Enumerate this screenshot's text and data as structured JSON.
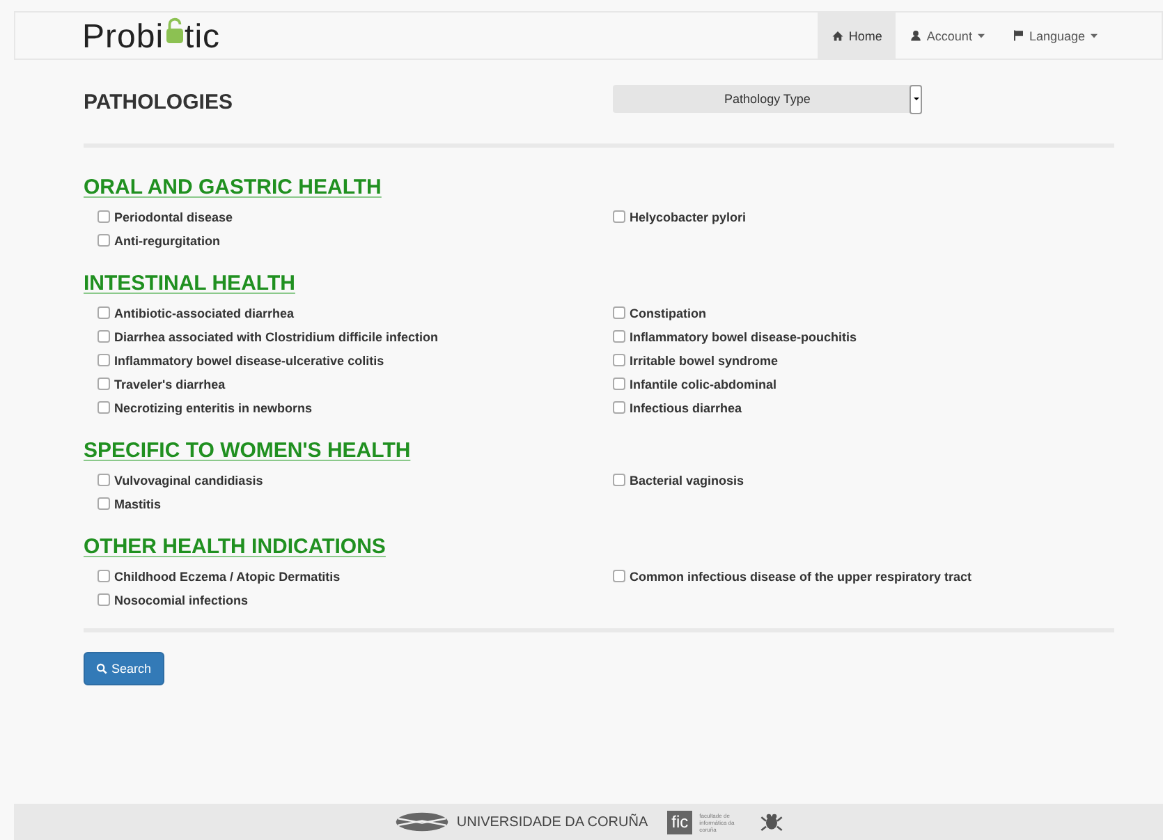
{
  "navbar": {
    "logo": {
      "before": "Probi",
      "after": "tic"
    },
    "items": [
      {
        "label": "Home",
        "kind": "home",
        "selected": true,
        "dropdown": false
      },
      {
        "label": "Account",
        "kind": "user",
        "selected": false,
        "dropdown": true
      },
      {
        "label": "Language",
        "kind": "flag",
        "selected": false,
        "dropdown": true
      }
    ]
  },
  "page_title": "PATHOLOGIES",
  "type_select": {
    "value": "Pathology Type"
  },
  "sections": [
    {
      "title": "ORAL AND GASTRIC HEALTH",
      "items": [
        {
          "label": "Periodontal disease",
          "checked": false
        },
        {
          "label": "Helycobacter pylori",
          "checked": false
        },
        {
          "label": "Anti-regurgitation",
          "checked": false
        }
      ]
    },
    {
      "title": "INTESTINAL HEALTH",
      "items": [
        {
          "label": "Antibiotic-associated diarrhea",
          "checked": false
        },
        {
          "label": "Constipation",
          "checked": false
        },
        {
          "label": "Diarrhea associated with Clostridium difficile infection",
          "checked": false
        },
        {
          "label": "Inflammatory bowel disease-pouchitis",
          "checked": false
        },
        {
          "label": "Inflammatory bowel disease-ulcerative colitis",
          "checked": false
        },
        {
          "label": "Irritable bowel syndrome",
          "checked": false
        },
        {
          "label": "Traveler's diarrhea",
          "checked": false
        },
        {
          "label": "Infantile colic-abdominal",
          "checked": false
        },
        {
          "label": "Necrotizing enteritis in newborns",
          "checked": false
        },
        {
          "label": "Infectious diarrhea",
          "checked": false
        }
      ]
    },
    {
      "title": "SPECIFIC TO WOMEN'S HEALTH",
      "items": [
        {
          "label": "Vulvovaginal candidiasis",
          "checked": false
        },
        {
          "label": "Bacterial vaginosis",
          "checked": false
        },
        {
          "label": "Mastitis",
          "checked": false
        }
      ]
    },
    {
      "title": "OTHER HEALTH INDICATIONS",
      "items": [
        {
          "label": "Childhood Eczema / Atopic Dermatitis",
          "checked": false
        },
        {
          "label": "Common infectious disease of the upper respiratory tract",
          "checked": false
        },
        {
          "label": "Nosocomial infections",
          "checked": false
        }
      ]
    }
  ],
  "search_button": "Search",
  "footer": {
    "university": "UNIVERSIDADE DA CORUÑA",
    "faculty_mark": "fic",
    "faculty_name": "facultade de informática da coruña"
  }
}
